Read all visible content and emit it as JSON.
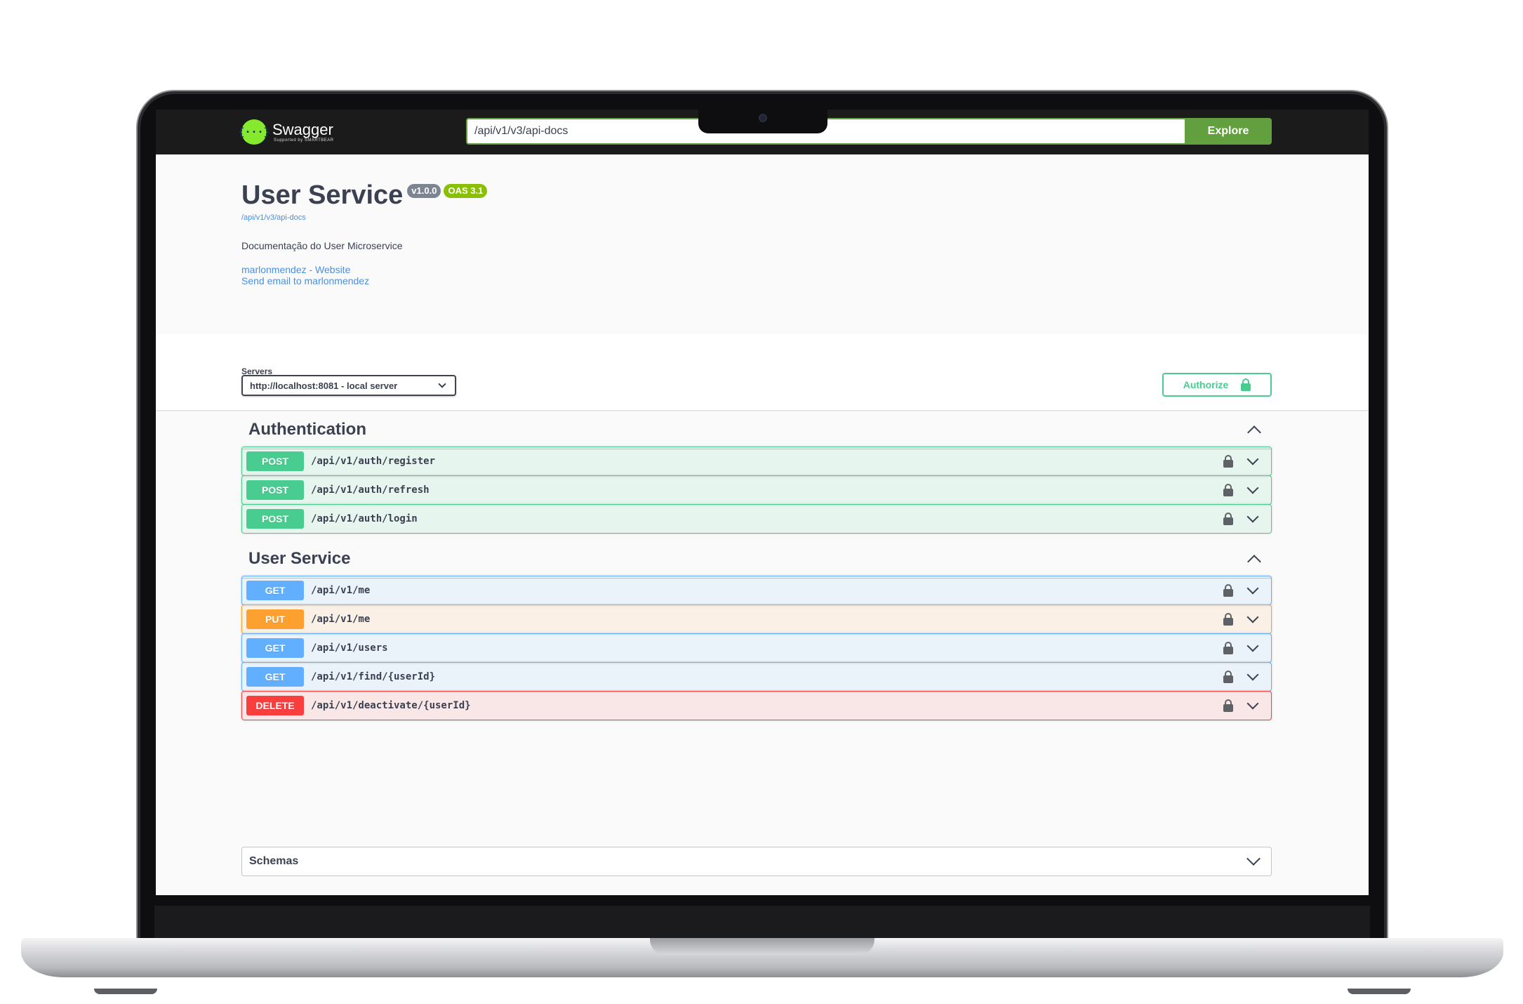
{
  "topbar": {
    "logo_name": "Swagger",
    "logo_sub": "Supported by SMARTBEAR",
    "logo_mark": "{···}",
    "url_value": "/api/v1/v3/api-docs",
    "explore_label": "Explore"
  },
  "info": {
    "title": "User Service",
    "version": "v1.0.0",
    "oas": "OAS 3.1",
    "spec_link": "/api/v1/v3/api-docs",
    "description": "Documentação do User Microservice",
    "contact_website": "marlonmendez - Website",
    "contact_email": "Send email to marlonmendez"
  },
  "servers": {
    "label": "Servers",
    "selected": "http://localhost:8081 - local server"
  },
  "authorize": {
    "label": "Authorize"
  },
  "tags": [
    {
      "name": "Authentication",
      "operations": [
        {
          "method": "POST",
          "path": "/api/v1/auth/register"
        },
        {
          "method": "POST",
          "path": "/api/v1/auth/refresh"
        },
        {
          "method": "POST",
          "path": "/api/v1/auth/login"
        }
      ]
    },
    {
      "name": "User Service",
      "operations": [
        {
          "method": "GET",
          "path": "/api/v1/me"
        },
        {
          "method": "PUT",
          "path": "/api/v1/me"
        },
        {
          "method": "GET",
          "path": "/api/v1/users"
        },
        {
          "method": "GET",
          "path": "/api/v1/find/{userId}"
        },
        {
          "method": "DELETE",
          "path": "/api/v1/deactivate/{userId}"
        }
      ]
    }
  ],
  "schemas": {
    "label": "Schemas"
  },
  "colors": {
    "post": "#49cc90",
    "get": "#61affe",
    "put": "#fca130",
    "delete": "#f93e3e",
    "explore": "#62a03f",
    "topbar": "#1b1b1b"
  }
}
